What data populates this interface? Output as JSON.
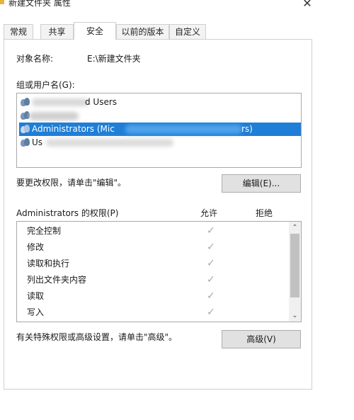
{
  "window": {
    "title": "新建文件夹 属性",
    "close_glyph": "✕"
  },
  "tabs": [
    {
      "label": "常规"
    },
    {
      "label": "共享"
    },
    {
      "label": "安全"
    },
    {
      "label": "以前的版本"
    },
    {
      "label": "自定义"
    }
  ],
  "active_tab": "安全",
  "object": {
    "label": "对象名称:",
    "value": "E:\\新建文件夹"
  },
  "group_users": {
    "label": "组或用户名(G):",
    "items": [
      {
        "name": "d Users"
      },
      {
        "name": ""
      },
      {
        "name": "Administrators (Mic",
        "suffix": "rs)"
      },
      {
        "name": "Us"
      }
    ],
    "selected_index": 2
  },
  "edit_section": {
    "hint": "要更改权限，请单击\"编辑\"。",
    "button": "编辑(E)..."
  },
  "permissions": {
    "title": "Administrators 的权限(P)",
    "allow_header": "允许",
    "deny_header": "拒绝",
    "check_glyph": "✓",
    "rows": [
      {
        "name": "完全控制"
      },
      {
        "name": "修改"
      },
      {
        "name": "读取和执行"
      },
      {
        "name": "列出文件夹内容"
      },
      {
        "name": "读取"
      },
      {
        "name": "写入"
      }
    ],
    "scroll_up_glyph": "⌃",
    "scroll_down_glyph": "⌄"
  },
  "advanced_section": {
    "hint": "有关特殊权限或高级设置，请单击\"高级\"。",
    "button": "高级(V)"
  },
  "colors": {
    "selection": "#1f7ed6",
    "button_bg": "#e1e1e1",
    "border": "#a9a9a9"
  }
}
